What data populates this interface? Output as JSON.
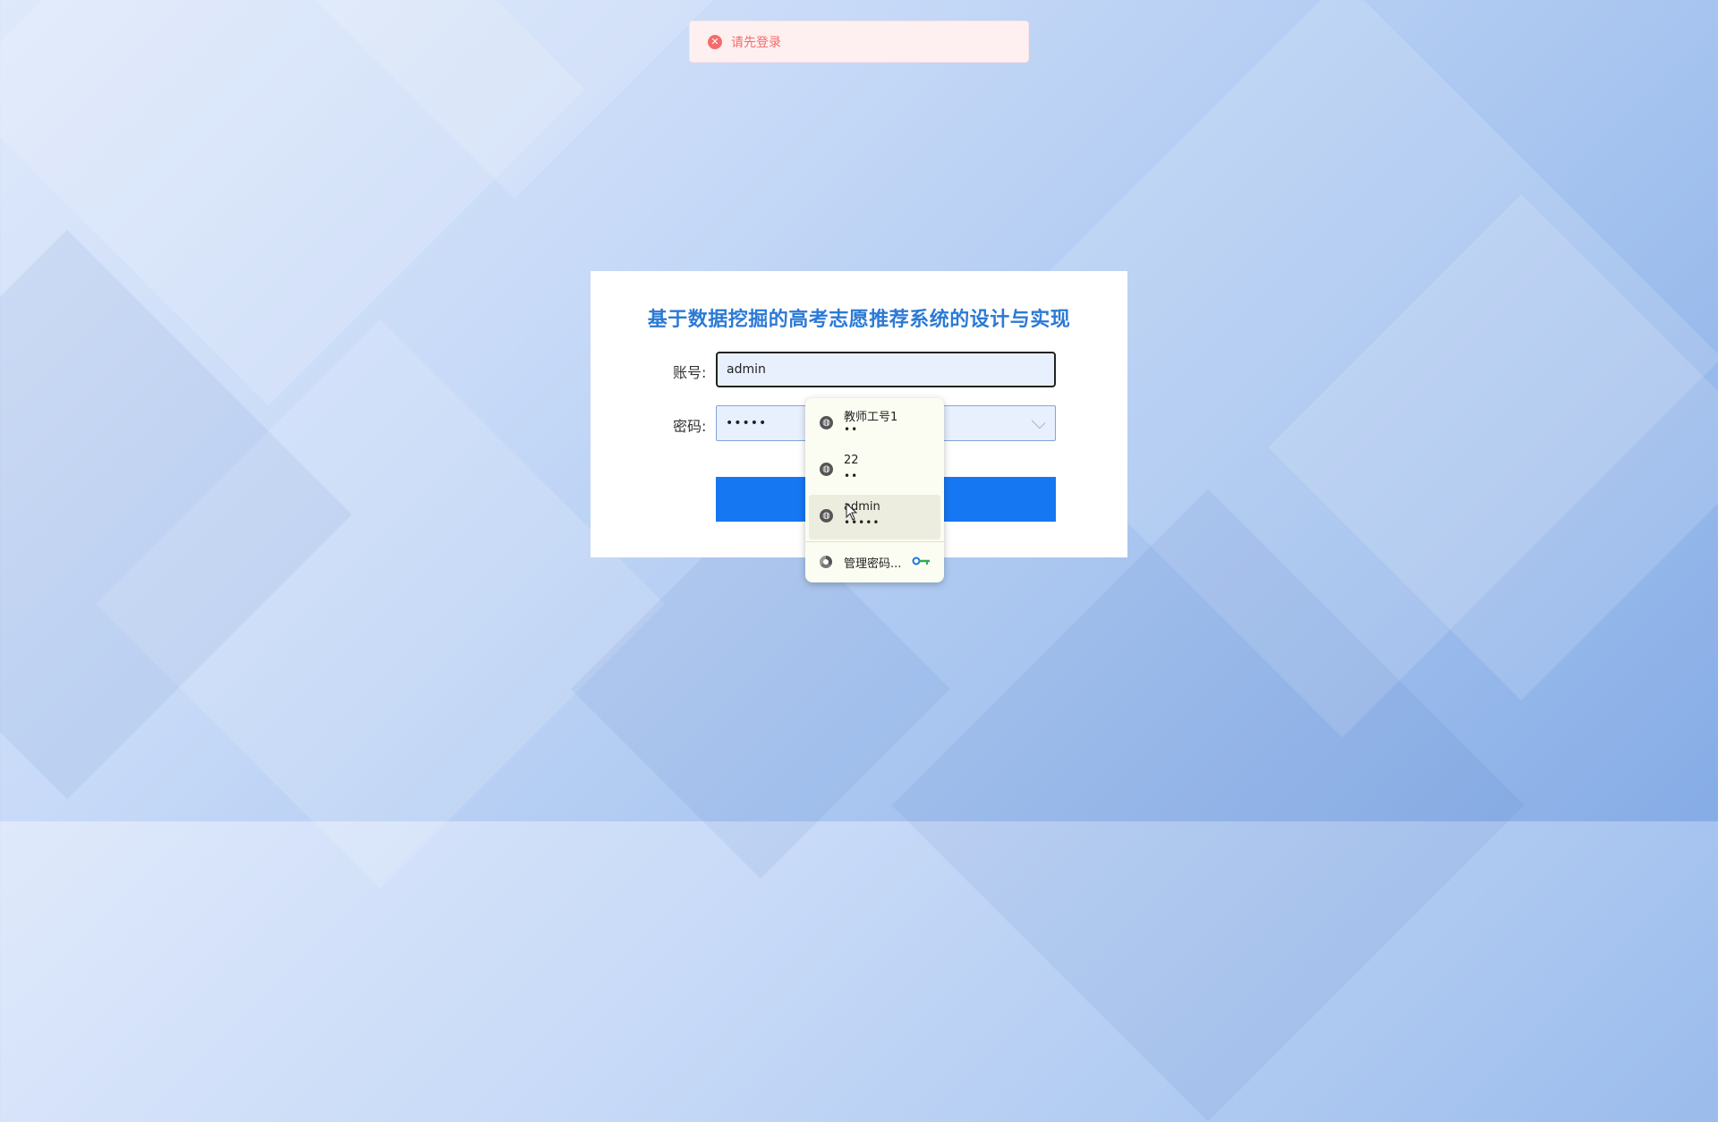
{
  "toast": {
    "message": "请先登录",
    "icon": "error-circle-icon",
    "color": "#f56c6c"
  },
  "login": {
    "title": "基于数据挖掘的高考志愿推荐系统的设计与实现",
    "account_label": "账号:",
    "account_value": "admin",
    "password_label": "密码:",
    "password_value": "•••••",
    "button_color": "#1677f2"
  },
  "autofill": {
    "items": [
      {
        "username": "教师工号1",
        "password": "••"
      },
      {
        "username": "22",
        "password": "••"
      },
      {
        "username": "admin",
        "password": "•••••"
      }
    ],
    "manage_label": "管理密码..."
  },
  "colors": {
    "title": "#2b7ad6",
    "accent": "#1677f2"
  }
}
